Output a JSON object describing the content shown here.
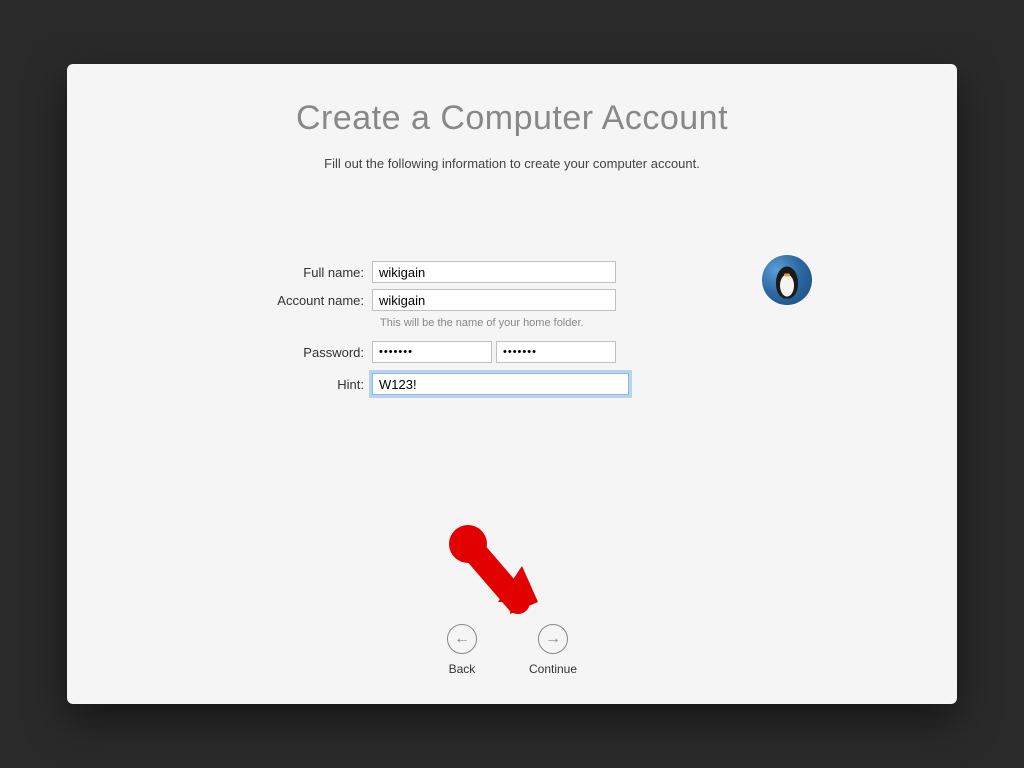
{
  "header": {
    "title": "Create a Computer Account",
    "subtitle": "Fill out the following information to create your computer account."
  },
  "form": {
    "full_name": {
      "label": "Full name:",
      "value": "wikigain"
    },
    "account_name": {
      "label": "Account name:",
      "value": "wikigain",
      "helper": "This will be the name of your home folder."
    },
    "password": {
      "label": "Password:",
      "value": "•••••••",
      "verify_value": "•••••••"
    },
    "hint": {
      "label": "Hint:",
      "value": "W123!"
    }
  },
  "avatar": {
    "name": "penguin-avatar"
  },
  "nav": {
    "back": "Back",
    "continue": "Continue"
  }
}
